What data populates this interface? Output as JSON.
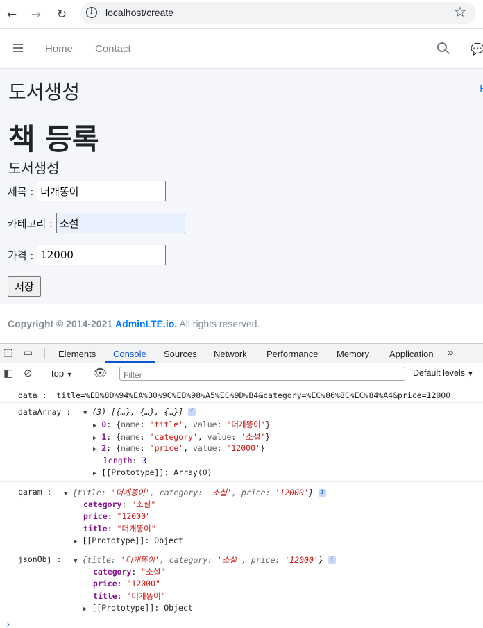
{
  "browser": {
    "url": "localhost/create"
  },
  "navbar": {
    "home": "Home",
    "contact": "Contact"
  },
  "content": {
    "page_title": "도서생성",
    "breadcrumb": "H",
    "heading": "책 등록",
    "subheading": "도서생성",
    "fields": {
      "title_label": "제목 :",
      "title_value": "더개똥이",
      "category_label": "카테고리 :",
      "category_value": "소설",
      "price_label": "가격 :",
      "price_value": "12000"
    },
    "save_label": "저장"
  },
  "footer": {
    "copyright": "Copyright © 2014-2021",
    "brand": "AdminLTE.io.",
    "rights": "All rights reserved."
  },
  "devtools": {
    "tabs": [
      "Elements",
      "Console",
      "Sources",
      "Network",
      "Performance",
      "Memory",
      "Application"
    ],
    "active_tab": "Console",
    "context": "top",
    "filter_placeholder": "Filter",
    "levels": "Default levels",
    "console": {
      "data_label": "data :",
      "data_value": "title=%EB%8D%94%EA%B0%9C%EB%98%A5%EC%9D%B4&category=%EC%86%8C%EC%84%A4&price=12000",
      "dataArray_label": "dataArray :",
      "dataArray_summary": "(3) [{…}, {…}, {…}]",
      "dataArray_items": [
        {
          "index": "0",
          "name": "'title'",
          "value": "'더개똥이'"
        },
        {
          "index": "1",
          "name": "'category'",
          "value": "'소설'"
        },
        {
          "index": "2",
          "name": "'price'",
          "value": "'12000'"
        }
      ],
      "length_key": "length",
      "length_value": "3",
      "proto_array": "[[Prototype]]: Array(0)",
      "param_label": "param :",
      "param_summary_open": "{title: ",
      "param_title": "'더개똥이'",
      "param_mid1": ", category: ",
      "param_category": "'소설'",
      "param_mid2": ", price: ",
      "param_price": "'12000'",
      "param_close": "}",
      "obj_category_key": "category",
      "obj_category_val": "\"소설\"",
      "obj_price_key": "price",
      "obj_price_val": "\"12000\"",
      "obj_title_key": "title",
      "obj_title_val": "\"더개똥이\"",
      "proto_object": "[[Prototype]]: Object",
      "jsonObj_label": "jsonObj :"
    }
  }
}
